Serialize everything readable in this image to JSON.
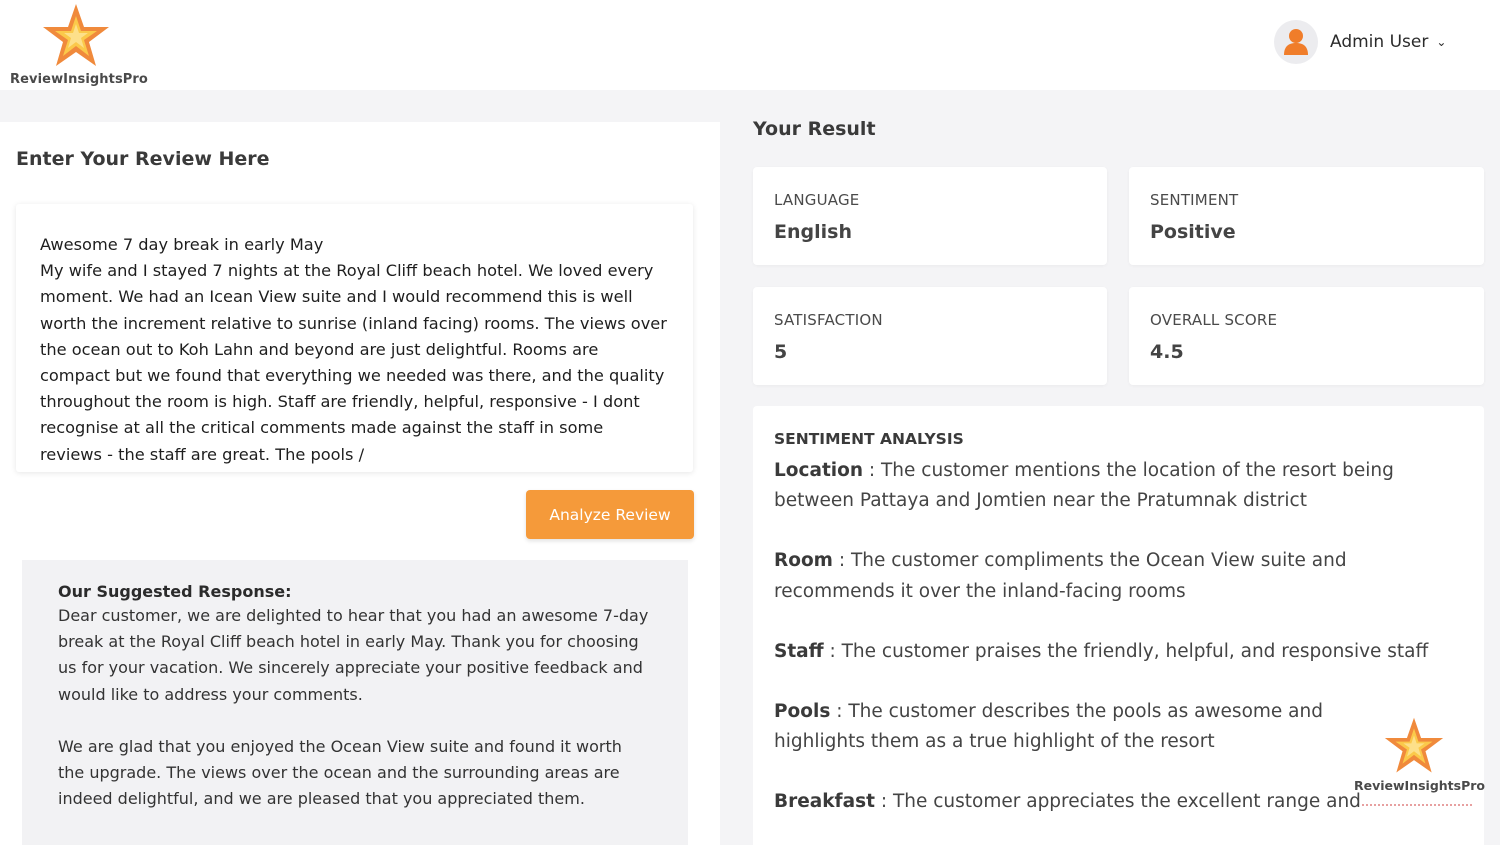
{
  "brand": {
    "name": "ReviewInsightsPro"
  },
  "user": {
    "name": "Admin User"
  },
  "left": {
    "title": "Enter Your Review Here",
    "review_text": "Awesome 7 day break in early May\nMy wife and I stayed 7 nights at the Royal Cliff beach hotel. We loved every moment. We had an Icean View suite and I would recommend this is well worth the increment relative to sunrise (inland facing) rooms. The views over the ocean out to Koh Lahn and beyond are just delightful. Rooms are compact but we found that everything we needed was there, and the quality throughout the room is high. Staff are friendly, helpful, responsive - I dont recognise at all the critical comments made against the staff in some reviews - the staff are great. The pools /",
    "analyze_label": "Analyze Review",
    "response_title": "Our Suggested Response:",
    "response_p1": "Dear customer, we are delighted to hear that you had an awesome 7-day break at the Royal Cliff beach hotel in early May. Thank you for choosing us for your vacation. We sincerely appreciate your positive feedback and would like to address your comments.",
    "response_p2": "We are glad that you enjoyed the Ocean View suite and found it worth the upgrade. The views over the ocean and the surrounding areas are indeed delightful, and we are pleased that you appreciated them."
  },
  "result": {
    "title": "Your Result",
    "cards": [
      {
        "label": "LANGUAGE",
        "value": "English"
      },
      {
        "label": "SENTIMENT",
        "value": "Positive"
      },
      {
        "label": "SATISFACTION",
        "value": "5"
      },
      {
        "label": "OVERALL SCORE",
        "value": "4.5"
      }
    ],
    "analysis_title": "SENTIMENT ANALYSIS",
    "analysis": [
      {
        "key": "Location",
        "text": " : The customer mentions the location of the resort being between Pattaya and Jomtien near the Pratumnak district"
      },
      {
        "key": "Room",
        "text": " : The customer compliments the Ocean View suite and recommends it over the inland-facing rooms"
      },
      {
        "key": "Staff",
        "text": " : The customer praises the friendly, helpful, and responsive staff"
      },
      {
        "key": "Pools",
        "text": " : The customer describes the pools as awesome and highlights them as a true highlight of the resort"
      },
      {
        "key": "Breakfast",
        "text": " : The customer appreciates the excellent range and"
      }
    ]
  },
  "icons": {
    "logo": "star-logo-icon",
    "avatar": "user-avatar-icon",
    "dropdown": "chevron-down-icon"
  },
  "colors": {
    "accent": "#f59a3a",
    "background": "#f4f4f6",
    "star_outer": "#f08a3c",
    "star_inner": "#fbc94a"
  }
}
